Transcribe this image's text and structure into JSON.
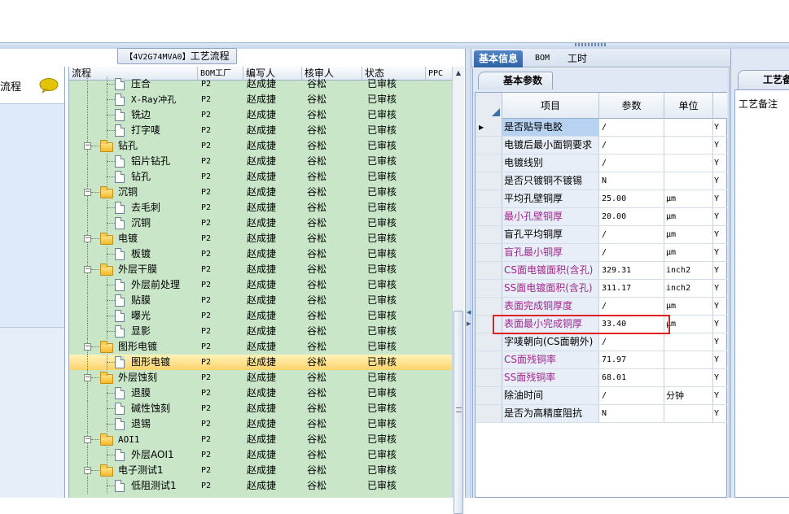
{
  "left_panel": {
    "label": "流程"
  },
  "process_title": {
    "code": "【4V2G74MVA0】",
    "text": "工艺流程"
  },
  "tree_grid": {
    "headers": {
      "flow": "流程",
      "bom": "BOM工厂",
      "writer": "编写人",
      "reviewer": "核审人",
      "status": "状态",
      "ppc": "PPC"
    },
    "rows": [
      {
        "name": "压合",
        "level": 2,
        "bom": "P2",
        "writer": "赵成捷",
        "reviewer": "谷松",
        "status": "已审核"
      },
      {
        "name": "X-Ray冲孔",
        "level": 2,
        "bom": "P2",
        "writer": "赵成捷",
        "reviewer": "谷松",
        "status": "已审核"
      },
      {
        "name": "铣边",
        "level": 2,
        "bom": "P2",
        "writer": "赵成捷",
        "reviewer": "谷松",
        "status": "已审核"
      },
      {
        "name": "打字唛",
        "level": 2,
        "bom": "P2",
        "writer": "赵成捷",
        "reviewer": "谷松",
        "status": "已审核"
      },
      {
        "name": "钻孔",
        "level": 1,
        "bom": "P2",
        "writer": "赵成捷",
        "reviewer": "谷松",
        "status": "已审核"
      },
      {
        "name": "铝片钻孔",
        "level": 2,
        "bom": "P2",
        "writer": "赵成捷",
        "reviewer": "谷松",
        "status": "已审核"
      },
      {
        "name": "钻孔",
        "level": 2,
        "bom": "P2",
        "writer": "赵成捷",
        "reviewer": "谷松",
        "status": "已审核"
      },
      {
        "name": "沉铜",
        "level": 1,
        "bom": "P2",
        "writer": "赵成捷",
        "reviewer": "谷松",
        "status": "已审核"
      },
      {
        "name": "去毛刺",
        "level": 2,
        "bom": "P2",
        "writer": "赵成捷",
        "reviewer": "谷松",
        "status": "已审核"
      },
      {
        "name": "沉铜",
        "level": 2,
        "bom": "P2",
        "writer": "赵成捷",
        "reviewer": "谷松",
        "status": "已审核"
      },
      {
        "name": "电镀",
        "level": 1,
        "bom": "P2",
        "writer": "赵成捷",
        "reviewer": "谷松",
        "status": "已审核"
      },
      {
        "name": "板镀",
        "level": 2,
        "bom": "P2",
        "writer": "赵成捷",
        "reviewer": "谷松",
        "status": "已审核"
      },
      {
        "name": "外层干膜",
        "level": 1,
        "bom": "P2",
        "writer": "赵成捷",
        "reviewer": "谷松",
        "status": "已审核"
      },
      {
        "name": "外层前处理",
        "level": 2,
        "bom": "P2",
        "writer": "赵成捷",
        "reviewer": "谷松",
        "status": "已审核"
      },
      {
        "name": "贴膜",
        "level": 2,
        "bom": "P2",
        "writer": "赵成捷",
        "reviewer": "谷松",
        "status": "已审核"
      },
      {
        "name": "曝光",
        "level": 2,
        "bom": "P2",
        "writer": "赵成捷",
        "reviewer": "谷松",
        "status": "已审核"
      },
      {
        "name": "显影",
        "level": 2,
        "bom": "P2",
        "writer": "赵成捷",
        "reviewer": "谷松",
        "status": "已审核"
      },
      {
        "name": "图形电镀",
        "level": 1,
        "bom": "P2",
        "writer": "赵成捷",
        "reviewer": "谷松",
        "status": "已审核"
      },
      {
        "name": "图形电镀",
        "level": 2,
        "bom": "P2",
        "writer": "赵成捷",
        "reviewer": "谷松",
        "status": "已审核",
        "selected": true
      },
      {
        "name": "外层蚀刻",
        "level": 1,
        "bom": "P2",
        "writer": "赵成捷",
        "reviewer": "谷松",
        "status": "已审核"
      },
      {
        "name": "退膜",
        "level": 2,
        "bom": "P2",
        "writer": "赵成捷",
        "reviewer": "谷松",
        "status": "已审核"
      },
      {
        "name": "碱性蚀刻",
        "level": 2,
        "bom": "P2",
        "writer": "赵成捷",
        "reviewer": "谷松",
        "status": "已审核"
      },
      {
        "name": "退锡",
        "level": 2,
        "bom": "P2",
        "writer": "赵成捷",
        "reviewer": "谷松",
        "status": "已审核"
      },
      {
        "name": "AOI1",
        "level": 1,
        "bom": "P2",
        "writer": "赵成捷",
        "reviewer": "谷松",
        "status": "已审核"
      },
      {
        "name": "外层AOI1",
        "level": 2,
        "bom": "P2",
        "writer": "赵成捷",
        "reviewer": "谷松",
        "status": "已审核"
      },
      {
        "name": "电子测试1",
        "level": 1,
        "bom": "P2",
        "writer": "赵成捷",
        "reviewer": "谷松",
        "status": "已审核"
      },
      {
        "name": "低阻测试1",
        "level": 2,
        "bom": "P2",
        "writer": "赵成捷",
        "reviewer": "谷松",
        "status": "已审核"
      }
    ]
  },
  "right_tabs": [
    "基本信息",
    "BOM",
    "工时"
  ],
  "param_panel": {
    "subtab": "基本参数",
    "headers": {
      "item": "项目",
      "param": "参数",
      "unit": "单位"
    },
    "rows": [
      {
        "name": "是否贴导电胶",
        "value": "/",
        "unit": "",
        "flag": "Y",
        "purple": false,
        "current": true
      },
      {
        "name": "电镀后最小面铜要求",
        "value": "/",
        "unit": "",
        "flag": "Y",
        "purple": false
      },
      {
        "name": "电镀线别",
        "value": "/",
        "unit": "",
        "flag": "Y",
        "purple": false
      },
      {
        "name": "是否只镀铜不镀锡",
        "value": "N",
        "unit": "",
        "flag": "Y",
        "purple": false
      },
      {
        "name": "平均孔壁铜厚",
        "value": "25.00",
        "unit": "μm",
        "flag": "Y",
        "purple": false
      },
      {
        "name": "最小孔壁铜厚",
        "value": "20.00",
        "unit": "μm",
        "flag": "Y",
        "purple": true
      },
      {
        "name": "盲孔平均铜厚",
        "value": "/",
        "unit": "μm",
        "flag": "Y",
        "purple": false
      },
      {
        "name": "盲孔最小铜厚",
        "value": "/",
        "unit": "μm",
        "flag": "Y",
        "purple": true
      },
      {
        "name": "CS面电镀面积(含孔)",
        "value": "329.31",
        "unit": "inch2",
        "flag": "Y",
        "purple": true
      },
      {
        "name": "SS面电镀面积(含孔)",
        "value": "311.17",
        "unit": "inch2",
        "flag": "Y",
        "purple": true
      },
      {
        "name": "表面完成铜厚度",
        "value": "/",
        "unit": "μm",
        "flag": "Y",
        "purple": true
      },
      {
        "name": "表面最小完成铜厚",
        "value": "33.40",
        "unit": "μm",
        "flag": "Y",
        "purple": true
      },
      {
        "name": "字唛朝向(CS面朝外)",
        "value": "/",
        "unit": "",
        "flag": "Y",
        "purple": false
      },
      {
        "name": "CS面残铜率",
        "value": "71.97",
        "unit": "",
        "flag": "Y",
        "purple": true
      },
      {
        "name": "SS面残铜率",
        "value": "68.01",
        "unit": "",
        "flag": "Y",
        "purple": true
      },
      {
        "name": "除油时间",
        "value": "/",
        "unit": "分钟",
        "flag": "Y",
        "purple": false
      },
      {
        "name": "是否为高精度阻抗",
        "value": "N",
        "unit": "",
        "flag": "Y",
        "purple": false
      }
    ]
  },
  "far_right": {
    "tab": "工艺备注",
    "label": "工艺备注"
  },
  "colors": {
    "tree_bg": "#c9e6c9",
    "selection": "#ffd36b",
    "highlight_box": "#e02020",
    "purple_text": "#a0268c",
    "active_tab": "#2f63a3"
  }
}
